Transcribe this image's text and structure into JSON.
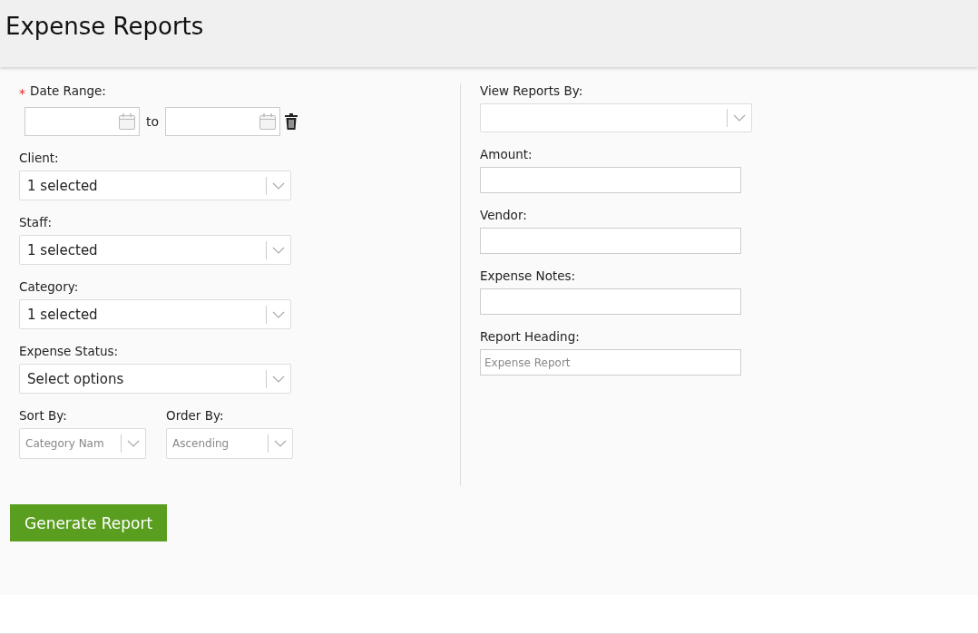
{
  "page": {
    "title": "Expense Reports"
  },
  "date_range": {
    "label": "Date Range:",
    "required_mark": "*",
    "separator": "to"
  },
  "left_fields": [
    {
      "label": "Client:",
      "value": "1 selected"
    },
    {
      "label": "Staff:",
      "value": "1 selected"
    },
    {
      "label": "Category:",
      "value": "1 selected"
    },
    {
      "label": "Expense Status:",
      "value": "Select options"
    }
  ],
  "sort_fields": [
    {
      "label": "Sort By:",
      "value": "Category Nam"
    },
    {
      "label": "Order By:",
      "value": "Ascending"
    }
  ],
  "view_reports_by": {
    "label": "View Reports By:"
  },
  "right_fields": [
    {
      "label": "Amount:"
    },
    {
      "label": "Vendor:"
    },
    {
      "label": "Expense Notes:"
    },
    {
      "label": "Report Heading:",
      "placeholder": "Expense Report"
    }
  ],
  "generate_button": "Generate Report"
}
